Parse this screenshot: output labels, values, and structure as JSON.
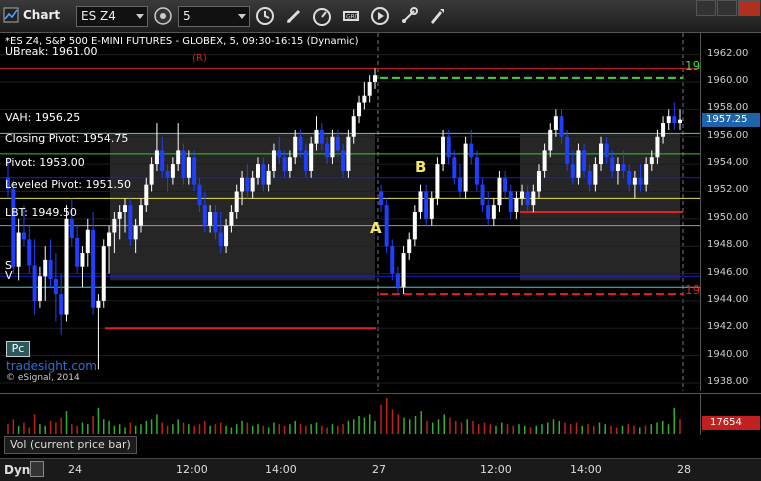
{
  "toolbar": {
    "app_title": "Chart",
    "symbol": "ES Z4",
    "interval": "5",
    "icons": [
      "link-icon",
      "clock-icon",
      "pencil-icon",
      "speedometer-icon",
      "grid-icon",
      "play-icon",
      "settings-icon"
    ]
  },
  "chart_title": "*ES Z4, S&P 500 E-MINI FUTURES - GLOBEX, 5, 09:30-16:15 (Dynamic)",
  "levels": {
    "ubreak": "UBreak: 1961.00",
    "vah": "VAH: 1956.25",
    "closing_pivot": "Closing Pivot: 1954.75",
    "pivot": "Pivot: 1953.00",
    "leveled_pivot": "Leveled Pivot: 1951.50",
    "lbt": "LBT: 1949.50",
    "s_label": "S",
    "v_label": "V"
  },
  "annotations": {
    "a": "A",
    "b": "B",
    "r_top": "19",
    "r_bottom": "19",
    "r_marker": "(R)"
  },
  "branding": {
    "pc": "Pc",
    "site": "tradesight.com",
    "copyright": "© eSignal, 2014"
  },
  "axis": {
    "ticks": [
      "1962.00",
      "1960.00",
      "1958.00",
      "1956.00",
      "1954.00",
      "1952.00",
      "1950.00",
      "1948.00",
      "1946.00",
      "1944.00",
      "1942.00",
      "1940.00",
      "1938.00"
    ],
    "last_price": "1957.25"
  },
  "volume": {
    "legend": "Vol (current price bar)",
    "last": "17654"
  },
  "timebar": {
    "mode": "Dyn",
    "labels": [
      "24",
      "12:00",
      "14:00",
      "27",
      "12:00",
      "14:00",
      "28"
    ]
  },
  "colors": {
    "up": "#ffffff",
    "down": "#1f3fff",
    "vah_line": "#38d0d0",
    "closing_pivot_line": "#30c830",
    "pivot_line": "#1a1ad0",
    "leveled_pivot_line": "#e8e040",
    "lbt_line": "#c080c0",
    "ubreak_line": "#d02020",
    "target_up": "#30e030",
    "target_down": "#e02020"
  },
  "chart_data": {
    "type": "candlestick",
    "series": [
      {
        "name": "ES Z4",
        "values": [
          [
            1953.0,
            1954.5,
            1951.5,
            1952.2
          ],
          [
            1952.2,
            1952.8,
            1946.0,
            1946.5
          ],
          [
            1946.5,
            1950.0,
            1945.5,
            1949.0
          ],
          [
            1949.0,
            1951.0,
            1948.0,
            1948.5
          ],
          [
            1948.5,
            1949.5,
            1946.0,
            1946.6
          ],
          [
            1946.6,
            1948.5,
            1943.0,
            1944.0
          ],
          [
            1944.0,
            1946.5,
            1943.5,
            1945.8
          ],
          [
            1945.8,
            1948.0,
            1944.0,
            1947.0
          ],
          [
            1947.0,
            1948.5,
            1945.0,
            1945.6
          ],
          [
            1945.6,
            1947.5,
            1942.5,
            1944.5
          ],
          [
            1944.5,
            1946.0,
            1941.5,
            1943.0
          ],
          [
            1943.0,
            1951.0,
            1942.5,
            1950.0
          ],
          [
            1950.0,
            1951.5,
            1948.0,
            1948.6
          ],
          [
            1948.6,
            1949.5,
            1946.0,
            1946.5
          ],
          [
            1946.5,
            1948.0,
            1945.0,
            1947.5
          ],
          [
            1947.5,
            1950.0,
            1946.5,
            1949.2
          ],
          [
            1949.2,
            1950.5,
            1943.0,
            1943.5
          ],
          [
            1943.5,
            1944.5,
            1939.0,
            1944.0
          ],
          [
            1944.0,
            1948.5,
            1943.5,
            1948.0
          ],
          [
            1948.0,
            1949.5,
            1946.0,
            1949.0
          ],
          [
            1949.0,
            1950.5,
            1947.5,
            1950.0
          ],
          [
            1950.0,
            1951.0,
            1948.5,
            1950.5
          ],
          [
            1950.5,
            1951.5,
            1949.0,
            1951.0
          ],
          [
            1951.0,
            1951.5,
            1948.0,
            1948.5
          ],
          [
            1948.5,
            1950.0,
            1947.5,
            1949.5
          ],
          [
            1949.5,
            1951.5,
            1949.0,
            1951.0
          ],
          [
            1951.0,
            1953.0,
            1950.5,
            1952.5
          ],
          [
            1952.5,
            1954.5,
            1952.0,
            1954.0
          ],
          [
            1954.0,
            1957.0,
            1953.5,
            1955.0
          ],
          [
            1955.0,
            1956.0,
            1953.0,
            1953.5
          ],
          [
            1953.5,
            1954.0,
            1952.0,
            1953.0
          ],
          [
            1953.0,
            1954.5,
            1952.5,
            1954.0
          ],
          [
            1954.0,
            1957.0,
            1953.5,
            1955.0
          ],
          [
            1955.0,
            1955.5,
            1952.5,
            1953.0
          ],
          [
            1953.0,
            1955.0,
            1952.5,
            1954.5
          ],
          [
            1954.5,
            1955.0,
            1952.0,
            1952.5
          ],
          [
            1952.5,
            1953.0,
            1950.5,
            1951.0
          ],
          [
            1951.0,
            1952.0,
            1949.0,
            1949.5
          ],
          [
            1949.5,
            1951.0,
            1949.0,
            1950.5
          ],
          [
            1950.5,
            1951.0,
            1948.5,
            1949.0
          ],
          [
            1949.0,
            1950.5,
            1947.5,
            1948.0
          ],
          [
            1948.0,
            1950.0,
            1947.5,
            1949.5
          ],
          [
            1949.5,
            1951.0,
            1949.0,
            1950.5
          ],
          [
            1950.5,
            1952.5,
            1950.0,
            1952.0
          ],
          [
            1952.0,
            1953.5,
            1951.0,
            1953.0
          ],
          [
            1953.0,
            1954.0,
            1951.5,
            1952.0
          ],
          [
            1952.0,
            1953.5,
            1951.5,
            1953.0
          ],
          [
            1953.0,
            1954.5,
            1952.5,
            1954.0
          ],
          [
            1954.0,
            1954.5,
            1952.0,
            1952.5
          ],
          [
            1952.5,
            1954.0,
            1952.0,
            1953.5
          ],
          [
            1953.5,
            1955.5,
            1953.0,
            1955.0
          ],
          [
            1955.0,
            1956.0,
            1954.0,
            1954.5
          ],
          [
            1954.5,
            1955.0,
            1953.0,
            1953.5
          ],
          [
            1953.5,
            1955.0,
            1953.0,
            1954.5
          ],
          [
            1954.5,
            1956.5,
            1954.0,
            1956.0
          ],
          [
            1956.0,
            1956.5,
            1954.5,
            1955.0
          ],
          [
            1955.0,
            1955.5,
            1953.0,
            1953.5
          ],
          [
            1953.5,
            1956.0,
            1953.0,
            1955.5
          ],
          [
            1955.5,
            1957.5,
            1955.0,
            1956.5
          ],
          [
            1956.5,
            1957.0,
            1955.0,
            1955.5
          ],
          [
            1955.5,
            1956.0,
            1954.0,
            1954.5
          ],
          [
            1954.5,
            1956.5,
            1954.0,
            1956.0
          ],
          [
            1956.0,
            1956.5,
            1954.5,
            1955.0
          ],
          [
            1955.0,
            1955.5,
            1953.0,
            1953.5
          ],
          [
            1953.5,
            1956.5,
            1953.0,
            1956.0
          ],
          [
            1956.0,
            1958.0,
            1955.5,
            1957.5
          ],
          [
            1957.5,
            1959.0,
            1957.0,
            1958.5
          ],
          [
            1958.5,
            1960.0,
            1958.0,
            1959.0
          ],
          [
            1959.0,
            1960.5,
            1958.5,
            1960.0
          ],
          [
            1960.0,
            1961.0,
            1959.5,
            1960.5
          ],
          [
            1952.0,
            1952.5,
            1950.5,
            1951.0
          ],
          [
            1951.0,
            1951.5,
            1947.5,
            1948.0
          ],
          [
            1948.0,
            1948.5,
            1945.5,
            1946.0
          ],
          [
            1946.0,
            1946.5,
            1944.5,
            1945.0
          ],
          [
            1945.0,
            1948.0,
            1944.5,
            1947.5
          ],
          [
            1947.5,
            1949.0,
            1947.0,
            1948.5
          ],
          [
            1948.5,
            1951.0,
            1948.0,
            1950.5
          ],
          [
            1950.5,
            1952.5,
            1950.0,
            1952.0
          ],
          [
            1952.0,
            1952.5,
            1949.5,
            1950.0
          ],
          [
            1950.0,
            1952.0,
            1949.5,
            1951.5
          ],
          [
            1951.5,
            1954.5,
            1951.0,
            1954.0
          ],
          [
            1954.0,
            1956.5,
            1953.5,
            1956.0
          ],
          [
            1956.0,
            1956.5,
            1954.0,
            1954.5
          ],
          [
            1954.5,
            1955.0,
            1952.5,
            1953.0
          ],
          [
            1953.0,
            1954.0,
            1951.5,
            1952.0
          ],
          [
            1952.0,
            1956.0,
            1951.5,
            1955.5
          ],
          [
            1955.5,
            1956.5,
            1954.0,
            1954.5
          ],
          [
            1954.5,
            1955.0,
            1952.0,
            1952.5
          ],
          [
            1952.5,
            1953.0,
            1950.5,
            1951.0
          ],
          [
            1951.0,
            1952.0,
            1949.5,
            1950.0
          ],
          [
            1950.0,
            1951.5,
            1949.5,
            1951.0
          ],
          [
            1951.0,
            1953.5,
            1950.5,
            1953.0
          ],
          [
            1953.0,
            1953.5,
            1951.5,
            1952.0
          ],
          [
            1952.0,
            1952.5,
            1950.0,
            1950.5
          ],
          [
            1950.5,
            1952.0,
            1950.0,
            1951.5
          ],
          [
            1951.5,
            1952.5,
            1951.0,
            1952.0
          ],
          [
            1952.0,
            1952.5,
            1950.5,
            1951.0
          ],
          [
            1951.0,
            1952.5,
            1950.5,
            1952.0
          ],
          [
            1952.0,
            1954.0,
            1951.5,
            1953.5
          ],
          [
            1953.5,
            1955.5,
            1953.0,
            1955.0
          ],
          [
            1955.0,
            1957.0,
            1954.5,
            1956.5
          ],
          [
            1956.5,
            1958.0,
            1956.0,
            1957.5
          ],
          [
            1957.5,
            1958.0,
            1955.5,
            1956.0
          ],
          [
            1956.0,
            1956.5,
            1953.5,
            1954.0
          ],
          [
            1954.0,
            1955.0,
            1952.5,
            1953.0
          ],
          [
            1953.0,
            1955.5,
            1952.5,
            1955.0
          ],
          [
            1955.0,
            1955.5,
            1953.0,
            1953.5
          ],
          [
            1953.5,
            1954.0,
            1952.0,
            1952.5
          ],
          [
            1952.5,
            1954.5,
            1952.0,
            1954.0
          ],
          [
            1954.0,
            1956.0,
            1953.5,
            1955.5
          ],
          [
            1955.5,
            1956.0,
            1954.0,
            1954.5
          ],
          [
            1954.5,
            1955.0,
            1953.0,
            1953.5
          ],
          [
            1953.5,
            1954.5,
            1952.5,
            1954.0
          ],
          [
            1954.0,
            1955.0,
            1953.0,
            1953.5
          ],
          [
            1953.5,
            1954.0,
            1952.0,
            1952.5
          ],
          [
            1952.5,
            1953.5,
            1951.5,
            1953.0
          ],
          [
            1953.0,
            1954.0,
            1952.0,
            1952.5
          ],
          [
            1952.5,
            1954.5,
            1952.0,
            1954.0
          ],
          [
            1954.0,
            1955.0,
            1953.5,
            1954.5
          ],
          [
            1954.5,
            1956.5,
            1954.0,
            1956.0
          ],
          [
            1956.0,
            1957.5,
            1955.5,
            1957.0
          ],
          [
            1957.0,
            1958.0,
            1956.5,
            1957.5
          ],
          [
            1957.5,
            1958.5,
            1956.5,
            1957.0
          ],
          [
            1957.0,
            1958.0,
            1956.5,
            1957.25
          ]
        ]
      }
    ],
    "volume": [
      6,
      9,
      5,
      7,
      4,
      12,
      6,
      5,
      8,
      7,
      10,
      14,
      6,
      5,
      7,
      6,
      11,
      16,
      9,
      8,
      5,
      6,
      4,
      7,
      5,
      6,
      8,
      9,
      12,
      7,
      5,
      6,
      9,
      7,
      6,
      5,
      6,
      8,
      5,
      6,
      7,
      5,
      4,
      6,
      8,
      7,
      5,
      6,
      5,
      4,
      7,
      6,
      5,
      6,
      8,
      6,
      5,
      6,
      7,
      5,
      4,
      6,
      5,
      6,
      8,
      9,
      11,
      10,
      12,
      8,
      18,
      22,
      15,
      12,
      10,
      9,
      11,
      14,
      8,
      7,
      9,
      12,
      10,
      8,
      7,
      9,
      8,
      6,
      7,
      6,
      5,
      7,
      6,
      5,
      6,
      5,
      4,
      5,
      6,
      7,
      9,
      8,
      7,
      6,
      7,
      5,
      6,
      5,
      7,
      6,
      5,
      4,
      5,
      6,
      5,
      4,
      5,
      6,
      7,
      8,
      6,
      16,
      9
    ],
    "ylim": [
      1938,
      1963
    ],
    "horizontal_lines": [
      {
        "name": "UBreak",
        "value": 1961.0
      },
      {
        "name": "VAH",
        "value": 1956.25
      },
      {
        "name": "Closing Pivot",
        "value": 1954.75
      },
      {
        "name": "Pivot",
        "value": 1953.0
      },
      {
        "name": "Leveled Pivot",
        "value": 1951.5
      },
      {
        "name": "LBT",
        "value": 1949.5
      }
    ]
  }
}
